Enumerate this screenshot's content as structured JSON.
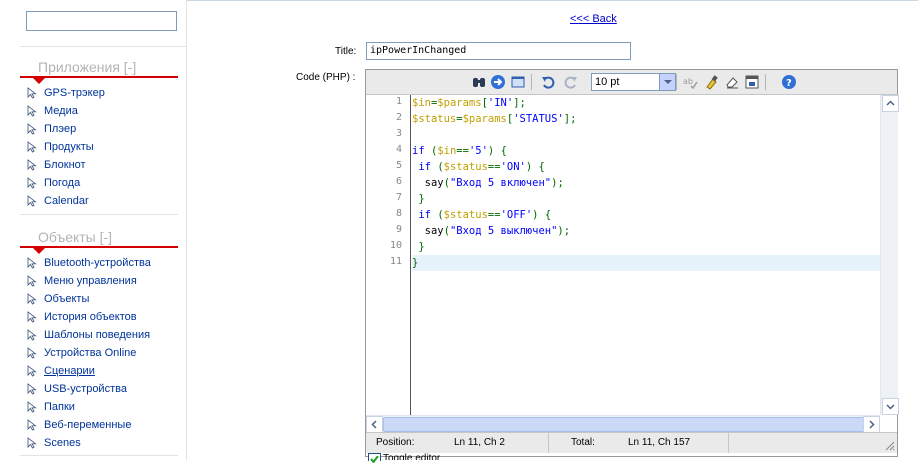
{
  "sidebar": {
    "search": {
      "value": ""
    },
    "sections": [
      {
        "title": "Приложения [-]",
        "items": [
          "GPS-трэкер",
          "Медиа",
          "Плэер",
          "Продукты",
          "Блокнот",
          "Погода",
          "Calendar"
        ]
      },
      {
        "title": "Объекты [-]",
        "items": [
          "Bluetooth-устройства",
          "Меню управления",
          "Объекты",
          "История объектов",
          "Шаблоны поведения",
          "Устройства Online",
          "Сценарии",
          "USB-устройства",
          "Папки",
          "Веб-переменные",
          "Scenes"
        ]
      }
    ],
    "item_icon": "pointer-arrow-icon"
  },
  "main": {
    "back_link": "<<< Back",
    "title_label": "Title:",
    "title_value": "ipPowerInChanged",
    "code_label": "Code (PHP) :"
  },
  "editor": {
    "toolbar": {
      "icons": [
        "search-icon",
        "goto-icon",
        "fullscreen-icon",
        "undo-icon",
        "redo-icon",
        "font-size-select",
        "spellcheck-icon",
        "highlight-icon",
        "erase-icon",
        "reset-icon",
        "help-icon"
      ],
      "font_size": "10 pt"
    },
    "line_numbers": [
      "1",
      "2",
      "3",
      "4",
      "5",
      "6",
      "7",
      "8",
      "9",
      "10",
      "11"
    ],
    "code_lines": [
      "$in=$params['IN'];",
      "$status=$params['STATUS'];",
      "",
      "if ($in=='5') {",
      " if ($status=='ON') {",
      "  say(\"Вход 5 включен\");",
      " }",
      " if ($status=='OFF') {",
      "  say(\"Вход 5 выключен\");",
      " }",
      "}"
    ],
    "status": {
      "position_label": "Position:",
      "position_value": "Ln 11, Ch 2",
      "total_label": "Total:",
      "total_value": "Ln 11, Ch 157"
    }
  },
  "colors": {
    "section_accent": "#d40000",
    "link": "#003399",
    "variable": "#c0a000",
    "string": "#0000ff",
    "keyword": "#0000ee"
  },
  "bottom_checkbox": {
    "checked": true,
    "label": "Toggle editor"
  }
}
